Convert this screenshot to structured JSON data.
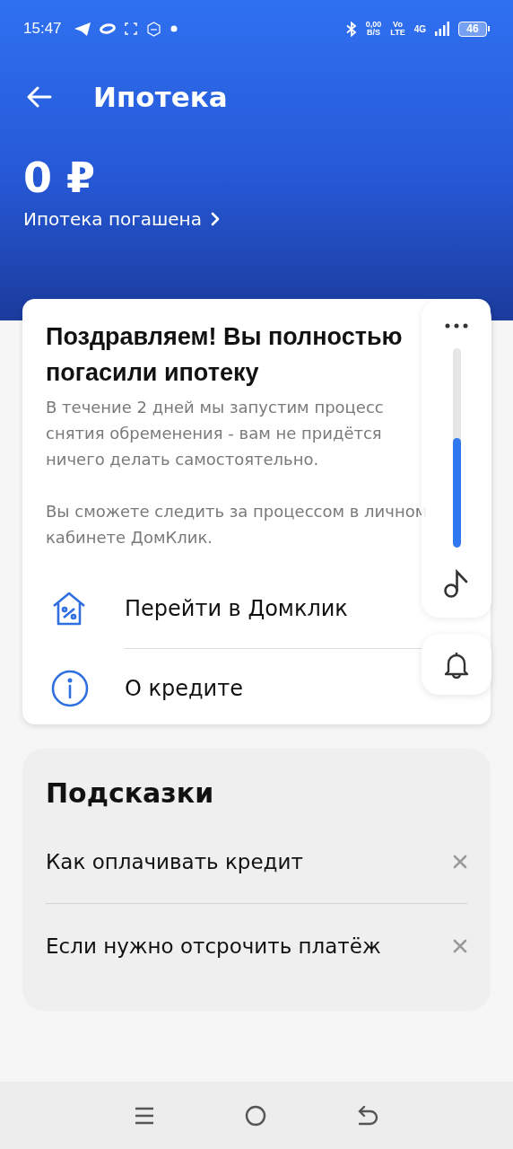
{
  "status_bar": {
    "time": "15:47",
    "net_speed": [
      "0,00",
      "B/S"
    ],
    "volte": [
      "Vo",
      "LTE"
    ],
    "network": "4G",
    "battery": "46"
  },
  "header": {
    "title": "Ипотека",
    "amount": "0 ₽",
    "status": "Ипотека погашена"
  },
  "notice": {
    "title": "Поздравляем! Вы полностью погасили ипотеку",
    "paragraphs": [
      "В течение 2 дней мы запустим процесс снятия обременения - вам не придётся ничего делать самостоятельно.",
      "Вы сможете следить за процессом в личном кабинете ДомКлик."
    ],
    "links": [
      {
        "kind": "house",
        "label": "Перейти в Домклик"
      },
      {
        "kind": "info",
        "label": "О кредите"
      }
    ]
  },
  "hints": {
    "title": "Подсказки",
    "items": [
      {
        "label": "Как оплачивать кредит"
      },
      {
        "label": "Если нужно отсрочить платёж"
      }
    ]
  },
  "volume": {
    "level": 0.55
  }
}
